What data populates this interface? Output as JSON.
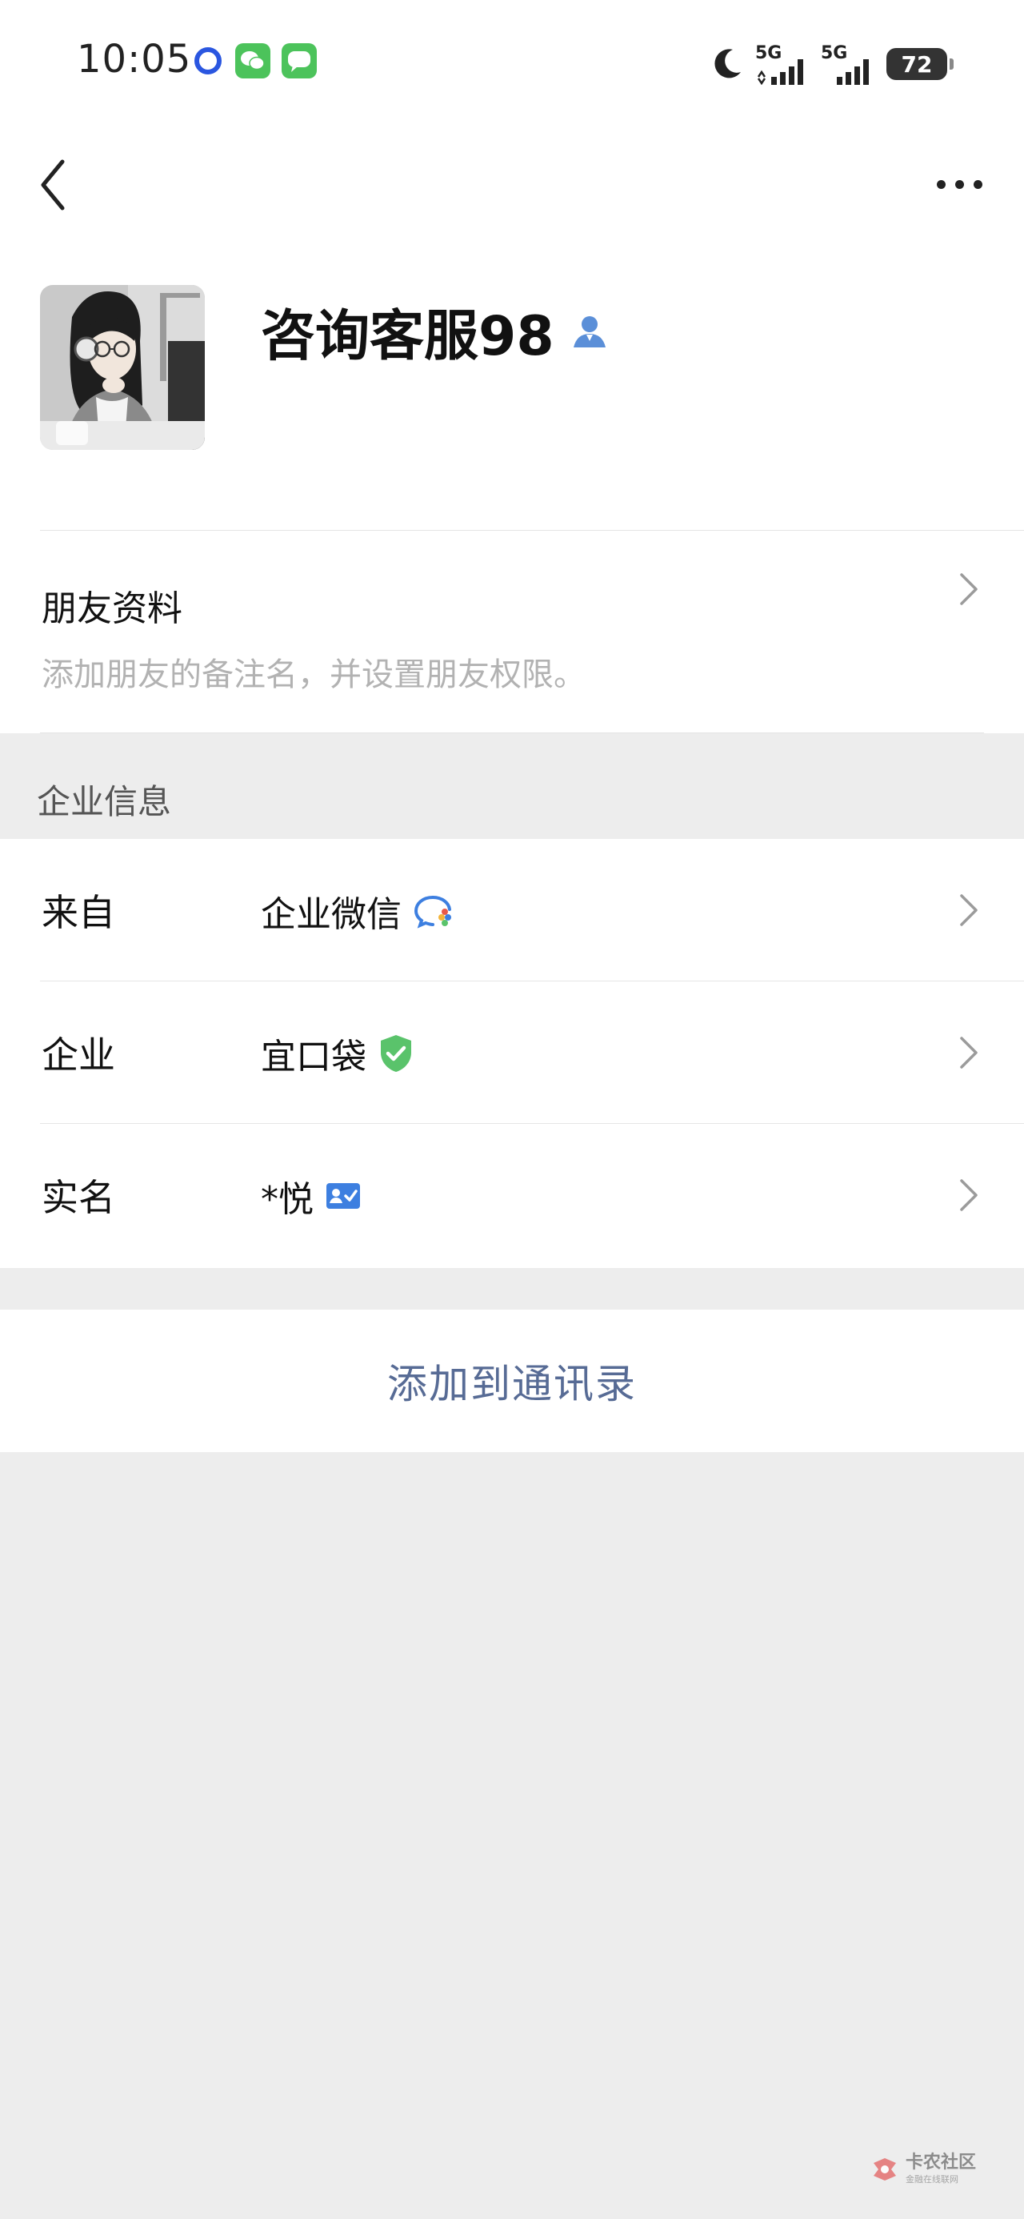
{
  "status_bar": {
    "time": "10:05",
    "network_1": "5G",
    "network_2": "5G",
    "battery": "72",
    "icons": [
      "app-circle-icon",
      "wechat-icon",
      "messages-icon",
      "moon-icon",
      "signal-icon",
      "signal-icon",
      "battery-icon"
    ]
  },
  "header": {
    "back_icon": "chevron-left-icon",
    "more_icon": "more-dots-icon",
    "name": "咨询客服98",
    "badge_icon": "enterprise-person-icon"
  },
  "friend_info": {
    "title": "朋友资料",
    "subtitle": "添加朋友的备注名，并设置朋友权限。"
  },
  "enterprise": {
    "section_label": "企业信息",
    "rows": [
      {
        "key": "来自",
        "value": "企业微信",
        "icon": "wecom-icon"
      },
      {
        "key": "企业",
        "value": "宜口袋",
        "icon": "verified-shield-icon"
      },
      {
        "key": "实名",
        "value": "*悦",
        "icon": "id-card-icon"
      }
    ]
  },
  "actions": {
    "add_contact": "添加到通讯录"
  },
  "watermark": {
    "line1": "卡农社区",
    "line2": "金融在线联网"
  },
  "colors": {
    "link": "#576b95",
    "wecom_blue": "#3d7fe0",
    "verified_green": "#5ac36b",
    "background": "#ededed"
  }
}
